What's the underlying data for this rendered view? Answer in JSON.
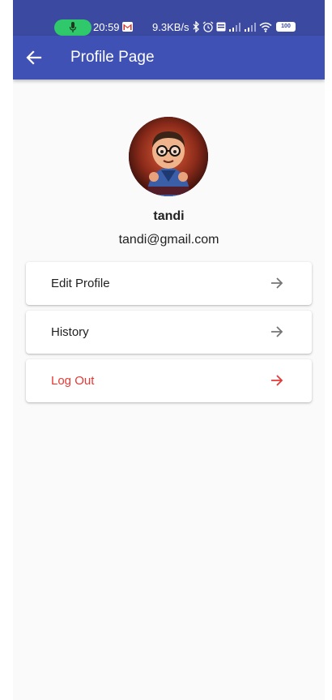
{
  "status_bar": {
    "time": "20:59",
    "net_speed": "9.3KB/s",
    "battery": "100",
    "icons": [
      "mic-icon",
      "gmail-icon",
      "bluetooth-icon",
      "alarm-icon",
      "volte-icon",
      "signal-icon",
      "signal-icon",
      "wifi-icon",
      "battery-icon"
    ]
  },
  "app_bar": {
    "title": "Profile Page",
    "back_icon": "arrow-left-icon"
  },
  "profile": {
    "name": "tandi",
    "email": "tandi@gmail.com"
  },
  "menu": [
    {
      "label": "Edit Profile",
      "icon": "arrow-right-icon",
      "color": "#212121"
    },
    {
      "label": "History",
      "icon": "arrow-right-icon",
      "color": "#212121"
    },
    {
      "label": "Log Out",
      "icon": "arrow-right-icon",
      "color": "#e53935"
    }
  ],
  "colors": {
    "status_bar": "#3b4aa0",
    "app_bar": "#3f51b5",
    "background": "#fafafa",
    "danger": "#e53935",
    "mic_pill": "#2fc96b"
  }
}
